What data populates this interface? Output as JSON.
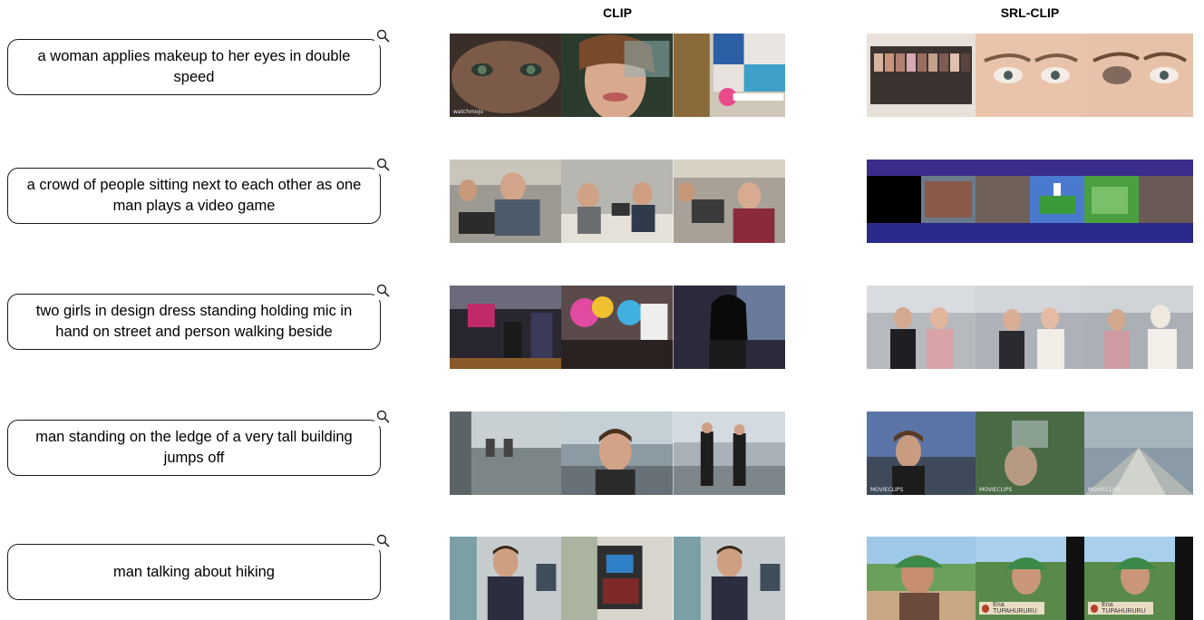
{
  "headers": {
    "clip": "CLIP",
    "srl_clip": "SRL-CLIP"
  },
  "queries": [
    {
      "text": "a woman applies makeup to her eyes in double speed"
    },
    {
      "text": "a crowd of people sitting next to each other as one man plays a video game"
    },
    {
      "text": "two girls in design dress standing holding mic in hand on street and person walking beside"
    },
    {
      "text": "man standing on the ledge of a very tall building jumps off"
    },
    {
      "text": "man talking about hiking"
    }
  ],
  "icons": {
    "query": "search-icon"
  },
  "frame_labels": {
    "watermark": "watchmojo",
    "skyline_watermark": "MOVIECLIPS",
    "name_tag": "Eria TUPAHURURU"
  }
}
